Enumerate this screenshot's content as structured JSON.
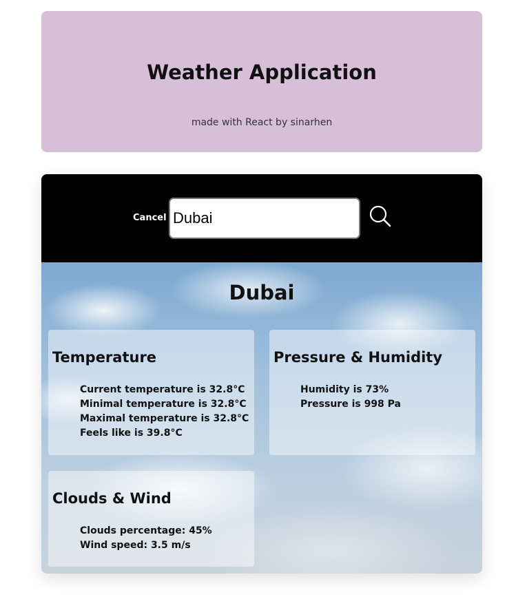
{
  "header": {
    "title": "Weather Application",
    "subtitle": "made with React by sinarhen",
    "background_color": "#d8bfd8"
  },
  "search": {
    "cancel_label": "Cancel",
    "value": "Dubai",
    "button_icon": "search-icon"
  },
  "weather": {
    "city": "Dubai",
    "temperature": {
      "title": "Temperature",
      "lines": [
        "Current temperature is 32.8°C",
        "Minimal temperature is 32.8°C",
        "Maximal temperature is 32.8°C",
        "Feels like is 39.8°C"
      ]
    },
    "pressure_humidity": {
      "title": "Pressure & Humidity",
      "lines": [
        "Humidity is 73%",
        "Pressure is 998 Pa"
      ]
    },
    "clouds_wind": {
      "title": "Clouds & Wind",
      "lines": [
        "Clouds percentage: 45%",
        "Wind speed: 3.5 m/s"
      ]
    }
  }
}
